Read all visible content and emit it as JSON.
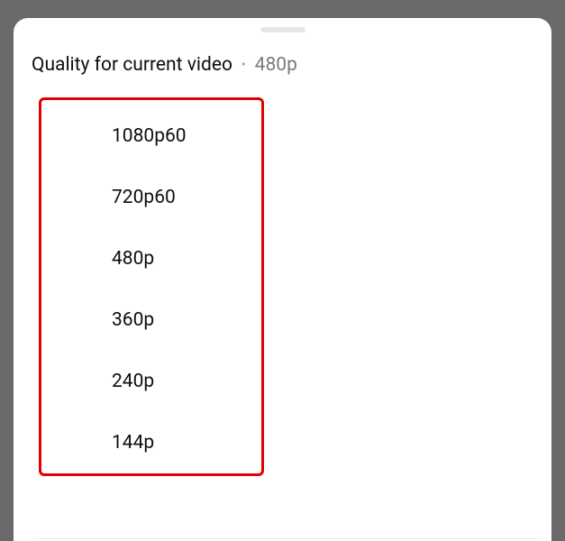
{
  "header": {
    "title": "Quality for current video",
    "separator": "•",
    "current": "480p"
  },
  "options": [
    {
      "label": "1080p60"
    },
    {
      "label": "720p60"
    },
    {
      "label": "480p"
    },
    {
      "label": "360p"
    },
    {
      "label": "240p"
    },
    {
      "label": "144p"
    }
  ]
}
